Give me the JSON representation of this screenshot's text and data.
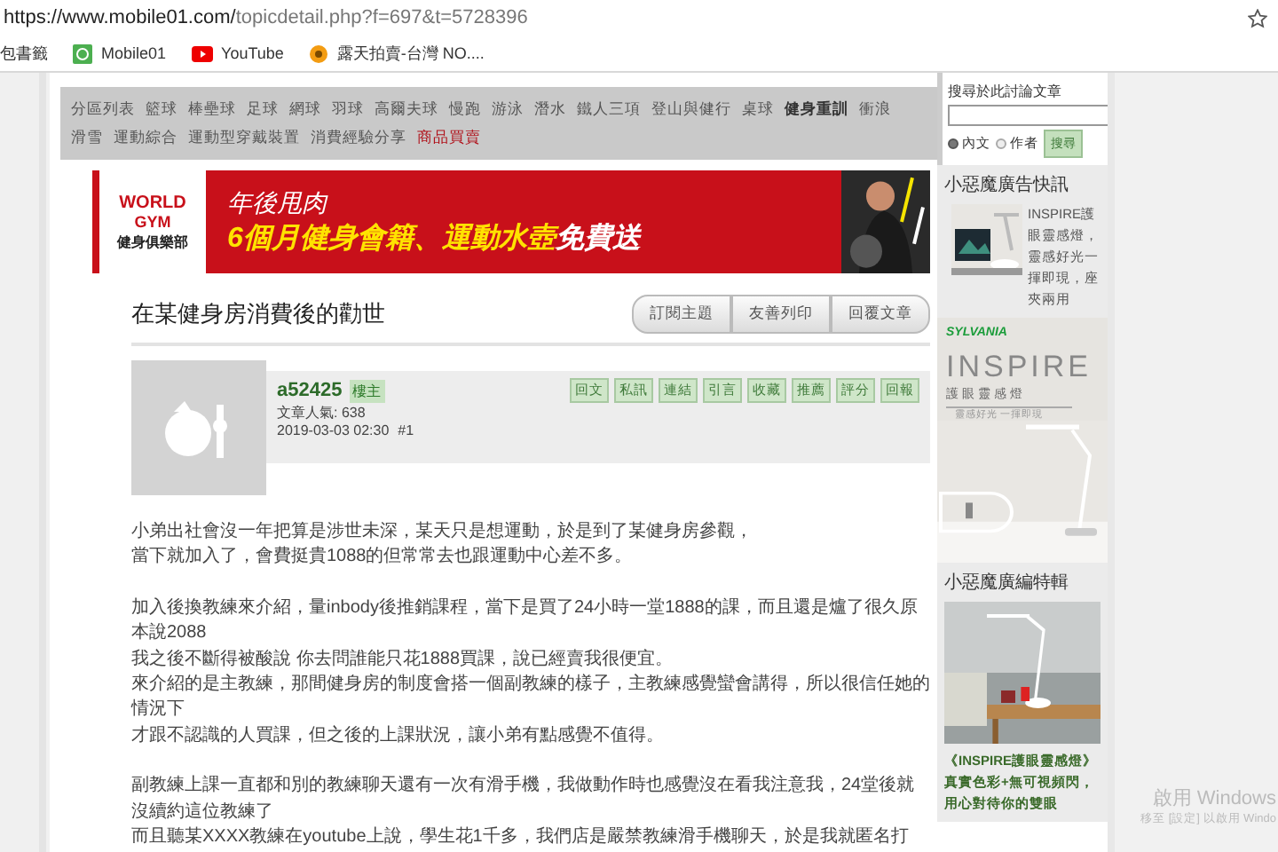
{
  "address_bar": {
    "url_host": "https://www.mobile01.com/",
    "url_path": "topicdetail.php?f=697&t=5728396"
  },
  "bookmarks": [
    "包書籤",
    "Mobile01",
    "YouTube",
    "露天拍賣-台灣 NO...."
  ],
  "forum_nav": [
    {
      "label": "分區列表",
      "kind": "link"
    },
    {
      "label": "籃球",
      "kind": "link"
    },
    {
      "label": "棒壘球",
      "kind": "link"
    },
    {
      "label": "足球",
      "kind": "link"
    },
    {
      "label": "網球",
      "kind": "link"
    },
    {
      "label": "羽球",
      "kind": "link"
    },
    {
      "label": "高爾夫球",
      "kind": "link"
    },
    {
      "label": "慢跑",
      "kind": "link"
    },
    {
      "label": "游泳",
      "kind": "link"
    },
    {
      "label": "潛水",
      "kind": "link"
    },
    {
      "label": "鐵人三項",
      "kind": "link"
    },
    {
      "label": "登山與健行",
      "kind": "link"
    },
    {
      "label": "桌球",
      "kind": "link"
    },
    {
      "label": "健身重訓",
      "kind": "current"
    },
    {
      "label": "衝浪",
      "kind": "link"
    },
    {
      "label": "滑雪",
      "kind": "link"
    },
    {
      "label": "運動綜合",
      "kind": "link"
    },
    {
      "label": "運動型穿戴裝置",
      "kind": "link"
    },
    {
      "label": "消費經驗分享",
      "kind": "link"
    },
    {
      "label": "商品買賣",
      "kind": "market"
    }
  ],
  "banner": {
    "brand_top": "WORLD",
    "brand_mid": "GYM",
    "brand_sub": "健身俱樂部",
    "headline": "年後甩肉",
    "offer_yellow": "6個月健身會籍、運動水壺",
    "offer_white": "免費送"
  },
  "topic": {
    "title": "在某健身房消費後的勸世",
    "buttons": [
      "訂閱主題",
      "友善列印",
      "回覆文章"
    ]
  },
  "post": {
    "author": "a52425",
    "badge": "樓主",
    "popularity": "文章人氣: 638",
    "timestamp": "2019-03-03 02:30",
    "floor": "#1",
    "actions": [
      "回文",
      "私訊",
      "連結",
      "引言",
      "收藏",
      "推薦",
      "評分",
      "回報"
    ],
    "paragraphs": [
      [
        "小弟出社會沒一年把算是涉世未深，某天只是想運動，於是到了某健身房參觀，",
        "當下就加入了，會費挺貴1088的但常常去也跟運動中心差不多。"
      ],
      [
        "加入後換教練來介紹，量inbody後推銷課程，當下是買了24小時一堂1888的課，而且還是爐了很久原本說2088",
        "我之後不斷得被酸說 你去問誰能只花1888買課，說已經賣我很便宜。",
        "來介紹的是主教練，那間健身房的制度會搭一個副教練的樣子，主教練感覺蠻會講得，所以很信任她的情況下",
        "才跟不認識的人買課，但之後的上課狀況，讓小弟有點感覺不值得。"
      ],
      [
        "副教練上課一直都和別的教練聊天還有一次有滑手機，我做動作時也感覺沒在看我注意我，24堂後就沒續約這位教練了",
        "而且聽某XXXX教練在youtube上說，學生花1千多，我們店是嚴禁教練滑手機聊天，於是我就匿名打"
      ]
    ]
  },
  "sidebar": {
    "search_title": "搜尋於此討論文章",
    "scopes": [
      {
        "label": "內文",
        "selected": true
      },
      {
        "label": "作者",
        "selected": false
      }
    ],
    "search_button": "搜尋",
    "ad_news_title": "小惡魔廣告快訊",
    "ad_news_text": "INSPIRE護眼靈感燈，靈感好光一揮即現，座夾兩用",
    "sponsor": {
      "brand": "SYLVANIA",
      "product": "INSPIRE",
      "subtitle": "護 眼 靈 感 燈",
      "tagline": "靈感好光 一揮即現"
    },
    "feature_title": "小惡魔廣編特輯",
    "feature_caption": "《INSPIRE護眼靈感燈》真實色彩+無可視頻閃，用心對待你的雙眼"
  },
  "os_notice": {
    "title": "啟用 Windows",
    "detail": "移至 [設定] 以啟用 Windo"
  }
}
